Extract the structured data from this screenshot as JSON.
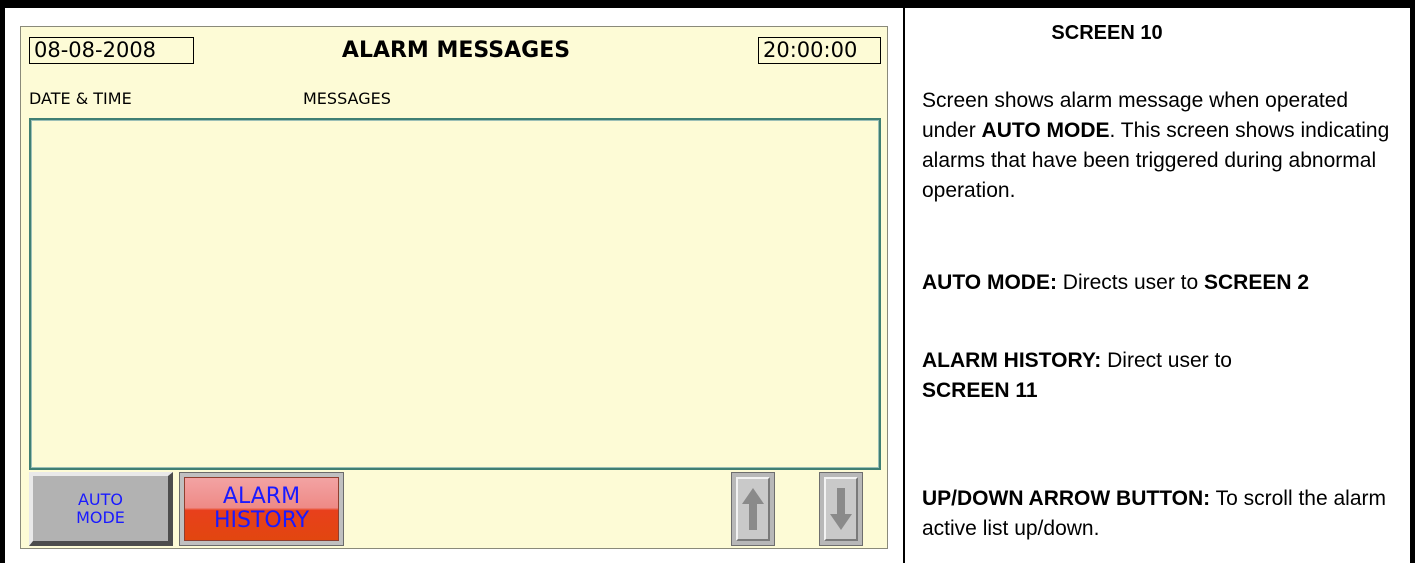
{
  "hmi": {
    "date": "08-08-2008",
    "title": "ALARM MESSAGES",
    "time": "20:00:00",
    "col_date": "DATE & TIME",
    "col_messages": "MESSAGES",
    "auto_mode_line1": "AUTO",
    "auto_mode_line2": "MODE",
    "alarm_history_line1": "ALARM",
    "alarm_history_line2": "HISTORY",
    "up_icon": "arrow-up-icon",
    "down_icon": "arrow-down-icon"
  },
  "description": {
    "screen_label": "SCREEN 10",
    "p1_a": "Screen shows alarm message when operated under ",
    "p1_b": "AUTO MODE",
    "p1_c": ". This screen shows indicating alarms that have been triggered during abnormal operation.",
    "p2_a": "AUTO MODE:",
    "p2_b": " Directs user to ",
    "p2_c": "SCREEN 2",
    "p3_a": "ALARM HISTORY:",
    "p3_b": " Direct user to ",
    "p3_c": "SCREEN 11",
    "p4_a": "UP/DOWN ARROW BUTTON:",
    "p4_b": " To scroll the alarm active list up/down."
  }
}
